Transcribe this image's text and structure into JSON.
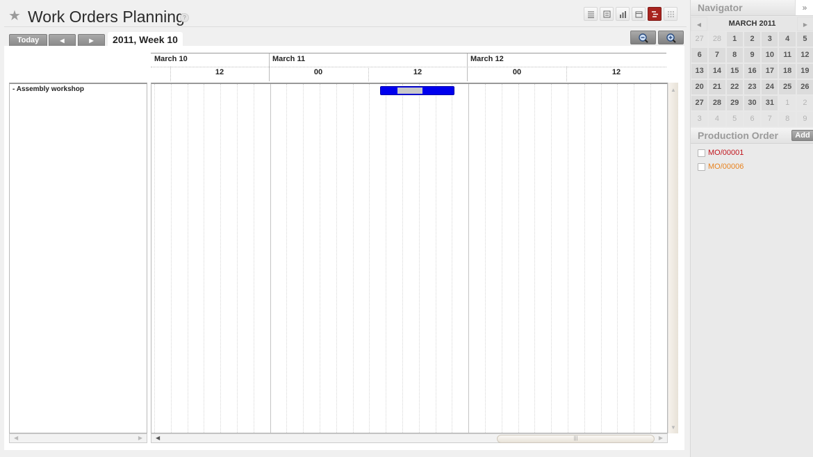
{
  "header": {
    "title": "Work Orders Planning",
    "help": "?"
  },
  "toolbar": {
    "today_label": "Today",
    "prev_glyph": "◀",
    "next_glyph": "▶",
    "period_label": "2011, Week 10"
  },
  "views": [
    {
      "name": "list-view",
      "icon": "list-icon",
      "active": false
    },
    {
      "name": "form-view",
      "icon": "form-icon",
      "active": false
    },
    {
      "name": "graph-view",
      "icon": "bar-chart-icon",
      "active": false
    },
    {
      "name": "calendar-view",
      "icon": "calendar-icon",
      "active": false
    },
    {
      "name": "gantt-view",
      "icon": "gantt-icon",
      "active": true
    },
    {
      "name": "kanban-view",
      "icon": "grid-icon",
      "active": false
    }
  ],
  "gantt": {
    "days": [
      "March 10",
      "March 11",
      "March 12"
    ],
    "hours": [
      "12",
      "00",
      "12",
      "00",
      "12"
    ],
    "group_label": "- Assembly workshop"
  },
  "sidebar": {
    "navigator_title": "Navigator",
    "toggle_glyph": "»",
    "month_label": "MARCH 2011",
    "weeks": [
      [
        {
          "d": "27",
          "m": true
        },
        {
          "d": "28",
          "m": true
        },
        {
          "d": "1"
        },
        {
          "d": "2"
        },
        {
          "d": "3"
        },
        {
          "d": "4"
        },
        {
          "d": "5"
        }
      ],
      [
        {
          "d": "6"
        },
        {
          "d": "7"
        },
        {
          "d": "8"
        },
        {
          "d": "9"
        },
        {
          "d": "10"
        },
        {
          "d": "11"
        },
        {
          "d": "12"
        }
      ],
      [
        {
          "d": "13"
        },
        {
          "d": "14"
        },
        {
          "d": "15"
        },
        {
          "d": "16"
        },
        {
          "d": "17"
        },
        {
          "d": "18"
        },
        {
          "d": "19"
        }
      ],
      [
        {
          "d": "20"
        },
        {
          "d": "21"
        },
        {
          "d": "22"
        },
        {
          "d": "23"
        },
        {
          "d": "24"
        },
        {
          "d": "25"
        },
        {
          "d": "26"
        }
      ],
      [
        {
          "d": "27"
        },
        {
          "d": "28"
        },
        {
          "d": "29"
        },
        {
          "d": "30"
        },
        {
          "d": "31"
        },
        {
          "d": "1",
          "m": true
        },
        {
          "d": "2",
          "m": true
        }
      ],
      [
        {
          "d": "3",
          "m": true
        },
        {
          "d": "4",
          "m": true
        },
        {
          "d": "5",
          "m": true
        },
        {
          "d": "6",
          "m": true
        },
        {
          "d": "7",
          "m": true
        },
        {
          "d": "8",
          "m": true
        },
        {
          "d": "9",
          "m": true
        }
      ]
    ],
    "production_title": "Production Order",
    "add_label": "Add",
    "orders": [
      {
        "name": "MO/00001",
        "color": "#c0141c"
      },
      {
        "name": "MO/00006",
        "color": "#e8821e"
      }
    ]
  },
  "colors": {
    "bar_fill": "#0000ee",
    "active_view": "#a8241f"
  }
}
